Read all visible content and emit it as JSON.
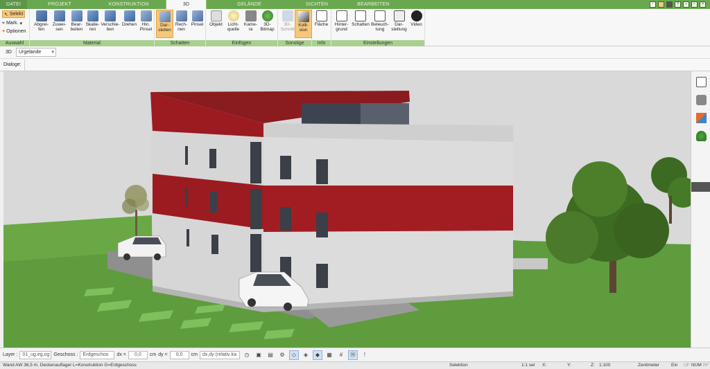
{
  "tabs": [
    "DATEI",
    "PROJEKT",
    "KONSTRUKTION",
    "3D",
    "GELÄNDE",
    "SICHTEN",
    "BEARBEITEN"
  ],
  "ribbon": {
    "auswahl": {
      "label": "Auswahl",
      "items": [
        "Selekt",
        "Mark.",
        "Optionen"
      ]
    },
    "material": {
      "label": "Material",
      "buttons": [
        "Abgrei-\nfen",
        "Zuwei-\nsen",
        "Bear-\nbeiten",
        "Skalie-\nren",
        "Verschie-\nben",
        "Drehen",
        "Hin.\nPinsel"
      ]
    },
    "schatten": {
      "label": "Schatten",
      "buttons": [
        "Dar-\nstellen",
        "Rech-\nnen",
        "Pinsel"
      ]
    },
    "einfuegen": {
      "label": "Einfügen",
      "buttons": [
        "Objekt",
        "Licht-\nquelle",
        "Kame-\nra",
        "3D-\nBitmap"
      ]
    },
    "sonstige": {
      "label": "Sonstige",
      "buttons": [
        "3D-\nSchnitt",
        "Kolli-\nsion"
      ]
    },
    "info": {
      "label": "Info",
      "buttons": [
        "Fläche"
      ]
    },
    "einstellungen": {
      "label": "Einstellungen",
      "buttons": [
        "Hinter-\ngrund",
        "Schatten",
        "Beleuch-\ntung",
        "Dar-\nstellung",
        "Video"
      ]
    }
  },
  "view_row": {
    "mode": "3D",
    "terrain": "Urgelände"
  },
  "dialog_row": {
    "label": "Dialoge:"
  },
  "bottom": {
    "layer_label": "Layer :",
    "layer_value": "01_ug.eg.og",
    "geschoss_label": "Geschoss :",
    "geschoss_value": "Erdgeschos",
    "dx_label": "dx =",
    "dx_value": "0,0",
    "dx_unit": "cm",
    "dy_label": "dy =",
    "dy_value": "0,0",
    "dy_unit": "cm",
    "mode_value": "dx,dy (relativ ka"
  },
  "status": {
    "message": "Wand AW 36,5 m. Deckenauflager L=Konstruktion G=Erdgeschoss",
    "selektion": "Selektion",
    "sel": "1:1 sel",
    "x": "X:",
    "y": "Y:",
    "z": "Z:",
    "scale": "1:100",
    "unit": "Zentimeter",
    "ein": "Ein",
    "uf": "UF",
    "num": "NUM",
    "rf": "RF"
  },
  "colors": {
    "accent": "#6aa84f",
    "group_label": "#a9d08e",
    "selected": "#f6c77a",
    "wall_red": "#9b1b20",
    "wall_grey": "#d4d4d4"
  }
}
